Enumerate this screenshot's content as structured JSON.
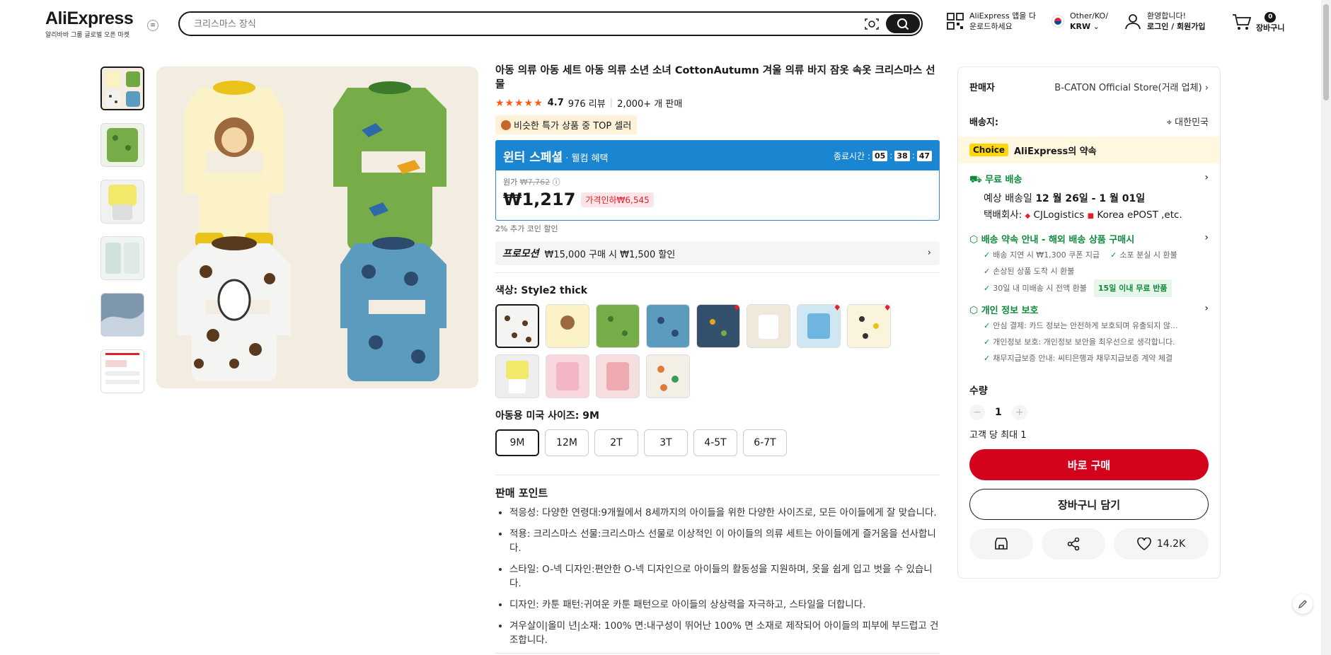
{
  "header": {
    "logo": "AliExpress",
    "logo_sub": "알리바바 그룹 글로벌 오픈 마켓",
    "search_placeholder": "크리스마스 장식",
    "app_line1": "AliExpress 앱을 다",
    "app_line2": "운로드하세요",
    "locale_line1": "Other/KO/",
    "locale_line2": "KRW",
    "account_line1": "환영합니다!",
    "account_line2": "로그인 / 회원가입",
    "cart_count": "0",
    "cart_label": "장바구니"
  },
  "product": {
    "title": "아동 의류 아동 세트 아동 의류 소년 소녀 CottonAutumn 겨울 의류 바지 잠옷 속옷 크리스마스 선물",
    "stars": "★★★★★",
    "rating": "4.7",
    "reviews": "976 리뷰",
    "sold": "2,000+ 개 판매",
    "top_badge": "비슷한 특가 상품 중 TOP 셀러"
  },
  "promo": {
    "title": "윈터 스페셜",
    "subtitle": " · 웰컴 혜택",
    "timer_label": "종료시간 :",
    "hh": "05",
    "mm": "38",
    "ss": "47",
    "orig_label": "원가",
    "orig_price": "₩7,762",
    "price": "₩1,217",
    "discount": "가격인하₩6,545",
    "coin": "2% 추가 코인 할인"
  },
  "promotion": {
    "label": "프로모션",
    "text": "₩15,000 구매 시 ₩1,500 할인"
  },
  "color": {
    "label": "색상: Style2 thick"
  },
  "size": {
    "label": "아동용 미국 사이즈: 9M",
    "options": [
      "9M",
      "12M",
      "2T",
      "3T",
      "4-5T",
      "6-7T"
    ]
  },
  "selling": {
    "title": "판매 포인트",
    "points": [
      "적응성: 다양한 연령대:9개월에서 8세까지의 아이들을 위한 다양한 사이즈로, 모든 아이들에게 잘 맞습니다.",
      "적용: 크리스마스 선물:크리스마스 선물로 이상적인 이 아이들의 의류 세트는 아이들에게 즐거움을 선사합니다.",
      "스타일: O-넥 디자인:편안한 O-넥 디자인으로 아이들의 활동성을 지원하며, 옷을 쉽게 입고 벗을 수 있습니다.",
      "디자인: 카툰 패턴:귀여운 카툰 패턴으로 아이들의 상상력을 자극하고, 스타일을 더합니다.",
      "겨우살이|올미 년|소재: 100% 면:내구성이 뛰어난 100% 면 소재로 제작되어 아이들의 피부에 부드럽고 건조합니다."
    ]
  },
  "panel": {
    "seller_label": "판매자",
    "seller": "B-CATON Official Store(거래 업체)",
    "ship_to_label": "배송지:",
    "ship_to": "대한민국",
    "choice_tag": "Choice",
    "choice_text": "AliExpress의 약속",
    "free_ship": "무료 배송",
    "eta_prefix": "예상 배송일 ",
    "eta": "12 월 26일 - 1 월 01일",
    "carrier_prefix": "택배회사:",
    "carrier1": "CJLogistics",
    "carrier2": "Korea ePOST ,etc.",
    "promise_title": "배송 약속 안내 - 해외 배송 상품 구매시",
    "promise1": "배송 지연 시 ₩1,300 쿠폰 지급",
    "promise2": "소포 분실 시 환불",
    "promise3": "손상된 상품 도착 시 환불",
    "promise4": "30일 내 미배송 시 전액 환불",
    "promise4_badge": "15일 이내 무료 반품",
    "privacy_title": "개인 정보 보호",
    "privacy1": "안심 결제: 카드 정보는 안전하게 보호되며 유출되지 않...",
    "privacy2": "개인정보 보호: 개인정보 보안을 최우선으로 생각합니다.",
    "privacy3": "채무지급보증 안내: 씨티은행과 채무지급보증 계약 체결",
    "qty_label": "수량",
    "qty": "1",
    "qty_limit": "고객 당 최대 1",
    "buy_now": "바로 구매",
    "add_cart": "장바구니 담기",
    "wishlist": "14.2K"
  }
}
